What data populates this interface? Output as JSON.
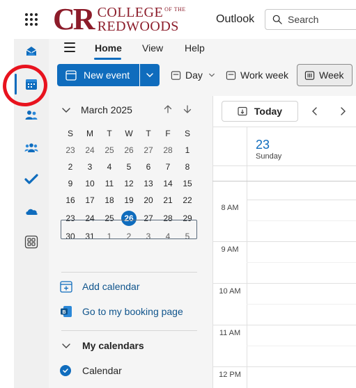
{
  "header": {
    "logo": {
      "initials": "CR",
      "line1": "COLLEGE",
      "line1_sup": "OF THE",
      "line2": "REDWOODS"
    },
    "app_name": "Outlook",
    "search_placeholder": "Search"
  },
  "rail": {
    "items": [
      {
        "name": "mail",
        "icon": "mail-icon"
      },
      {
        "name": "calendar",
        "icon": "calendar-icon",
        "active": true
      },
      {
        "name": "people",
        "icon": "people-icon"
      },
      {
        "name": "groups",
        "icon": "groups-icon"
      },
      {
        "name": "todo",
        "icon": "todo-check-icon"
      },
      {
        "name": "onedrive",
        "icon": "onedrive-cloud-icon"
      },
      {
        "name": "apps",
        "icon": "more-apps-icon"
      }
    ]
  },
  "ribbon": {
    "tabs": [
      "Home",
      "View",
      "Help"
    ],
    "active_tab": "Home",
    "new_event_label": "New event",
    "views": {
      "day": "Day",
      "work_week": "Work week",
      "week": "Week"
    }
  },
  "mini_calendar": {
    "month_label": "March 2025",
    "weekday_headers": [
      "S",
      "M",
      "T",
      "W",
      "T",
      "F",
      "S"
    ],
    "weeks": [
      [
        "23",
        "24",
        "25",
        "26",
        "27",
        "28",
        "1"
      ],
      [
        "2",
        "3",
        "4",
        "5",
        "6",
        "7",
        "8"
      ],
      [
        "9",
        "10",
        "11",
        "12",
        "13",
        "14",
        "15"
      ],
      [
        "16",
        "17",
        "18",
        "19",
        "20",
        "21",
        "22"
      ],
      [
        "23",
        "24",
        "25",
        "26",
        "27",
        "28",
        "29"
      ],
      [
        "30",
        "31",
        "1",
        "2",
        "3",
        "4",
        "5"
      ]
    ],
    "today": "26"
  },
  "left_pane": {
    "add_calendar": "Add calendar",
    "booking_page": "Go to my booking page",
    "my_calendars": "My calendars",
    "calendar_item": "Calendar"
  },
  "main": {
    "today_label": "Today",
    "day_number": "23",
    "day_name": "Sunday",
    "time_labels": [
      "8 AM",
      "9 AM",
      "10 AM",
      "11 AM",
      "12 PM"
    ]
  },
  "colors": {
    "accent": "#0f6cbd",
    "brand": "#8c1c2a",
    "annotation": "#e8131e"
  }
}
